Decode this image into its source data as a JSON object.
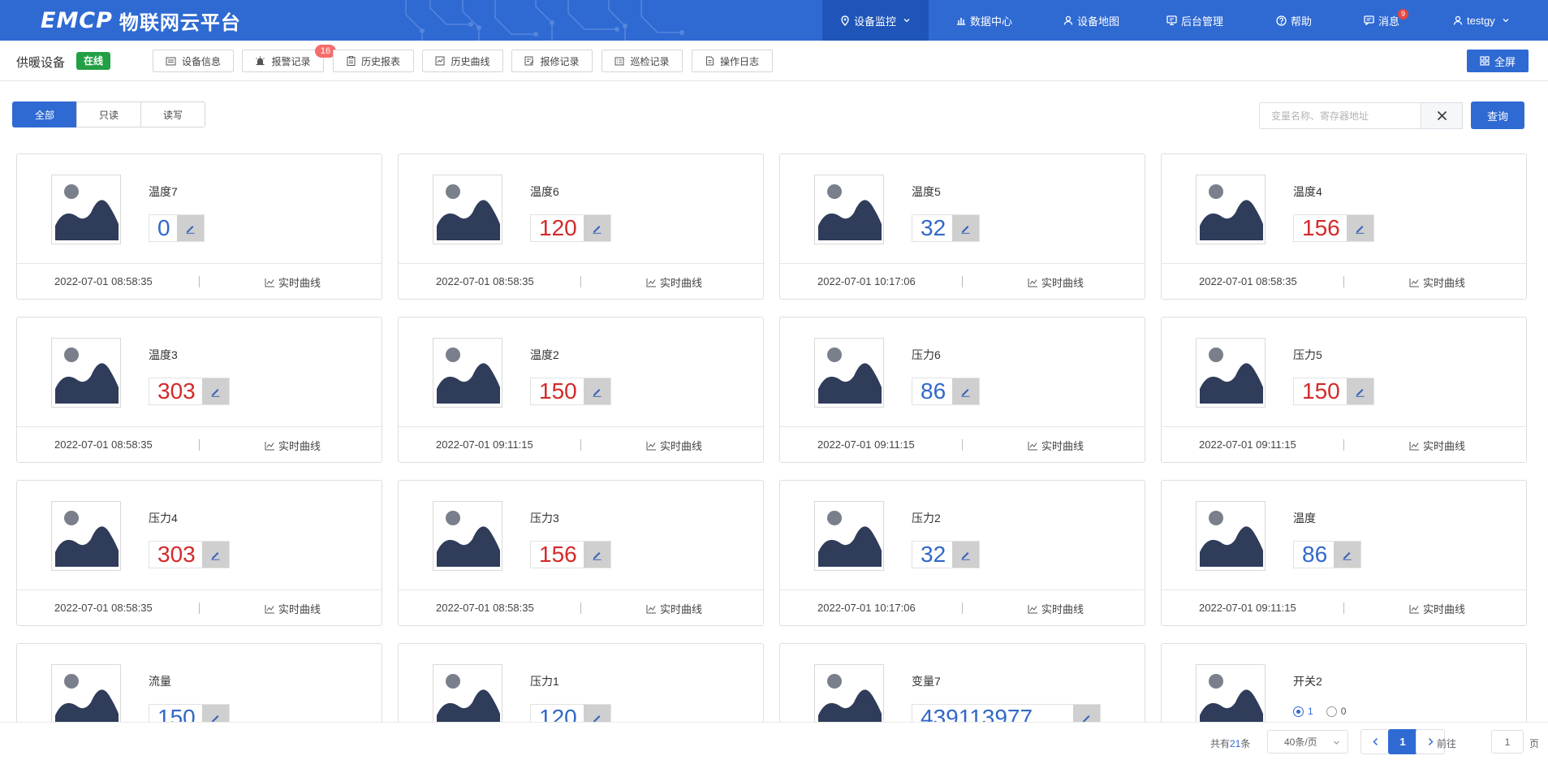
{
  "app": {
    "logo_mark": "EMCP",
    "logo_text": "物联网云平台"
  },
  "nav": [
    {
      "label": "设备监控",
      "icon": "location-pin-icon",
      "active": true,
      "dropdown": true
    },
    {
      "label": "数据中心",
      "icon": "bar-chart-icon"
    },
    {
      "label": "设备地图",
      "icon": "map-person-icon"
    },
    {
      "label": "后台管理",
      "icon": "monitor-icon"
    },
    {
      "label": "帮助",
      "icon": "help-circle-icon"
    },
    {
      "label": "消息",
      "icon": "message-icon",
      "badge": "9"
    },
    {
      "label": "testgy",
      "icon": "user-icon",
      "dropdown": true
    }
  ],
  "device": {
    "name": "供暖设备",
    "status": "在线"
  },
  "toolbar": [
    {
      "label": "设备信息",
      "icon": "device-info-icon"
    },
    {
      "label": "报警记录",
      "icon": "alarm-icon",
      "badge": "16"
    },
    {
      "label": "历史报表",
      "icon": "report-icon"
    },
    {
      "label": "历史曲线",
      "icon": "history-curve-icon"
    },
    {
      "label": "报修记录",
      "icon": "repair-icon"
    },
    {
      "label": "巡检记录",
      "icon": "inspection-icon"
    },
    {
      "label": "操作日志",
      "icon": "log-icon"
    }
  ],
  "fullscreen_label": "全屏",
  "filter": {
    "tabs": [
      "全部",
      "只读",
      "读写"
    ],
    "active_tab": 0,
    "search_placeholder": "变量名称、寄存器地址",
    "search_value": "",
    "query_label": "查询"
  },
  "curve_label": "实时曲线",
  "colors": {
    "primary": "#2f6ad3",
    "online": "#23a045",
    "value_red": "#d42a2a",
    "value_blue": "#3168c9",
    "badge": "#f56c6c"
  },
  "cards": [
    {
      "name": "温度7",
      "value": "0",
      "color": "blue",
      "time": "2022-07-01 08:58:35"
    },
    {
      "name": "温度6",
      "value": "120",
      "color": "red",
      "time": "2022-07-01 08:58:35"
    },
    {
      "name": "温度5",
      "value": "32",
      "color": "blue",
      "time": "2022-07-01 10:17:06"
    },
    {
      "name": "温度4",
      "value": "156",
      "color": "red",
      "time": "2022-07-01 08:58:35"
    },
    {
      "name": "温度3",
      "value": "303",
      "color": "red",
      "time": "2022-07-01 08:58:35"
    },
    {
      "name": "温度2",
      "value": "150",
      "color": "red",
      "time": "2022-07-01 09:11:15"
    },
    {
      "name": "压力6",
      "value": "86",
      "color": "blue",
      "time": "2022-07-01 09:11:15"
    },
    {
      "name": "压力5",
      "value": "150",
      "color": "red",
      "time": "2022-07-01 09:11:15"
    },
    {
      "name": "压力4",
      "value": "303",
      "color": "red",
      "time": "2022-07-01 08:58:35"
    },
    {
      "name": "压力3",
      "value": "156",
      "color": "red",
      "time": "2022-07-01 08:58:35"
    },
    {
      "name": "压力2",
      "value": "32",
      "color": "blue",
      "time": "2022-07-01 10:17:06"
    },
    {
      "name": "温度",
      "value": "86",
      "color": "blue",
      "time": "2022-07-01 09:11:15"
    },
    {
      "name": "流量",
      "value": "150",
      "color": "blue",
      "time": ""
    },
    {
      "name": "压力1",
      "value": "120",
      "color": "blue",
      "time": ""
    },
    {
      "name": "变量7",
      "value": "439113977",
      "color": "blue",
      "time": "",
      "wide": true
    },
    {
      "name": "开关2",
      "type": "switch",
      "options": [
        "1",
        "0"
      ],
      "selected": 0,
      "time": ""
    }
  ],
  "pagination": {
    "total_prefix": "共有",
    "total": "21",
    "total_suffix": "条",
    "page_size": "40条/页",
    "current_page": "1",
    "goto_label": "前往",
    "goto_value": "1",
    "page_suffix": "页"
  }
}
